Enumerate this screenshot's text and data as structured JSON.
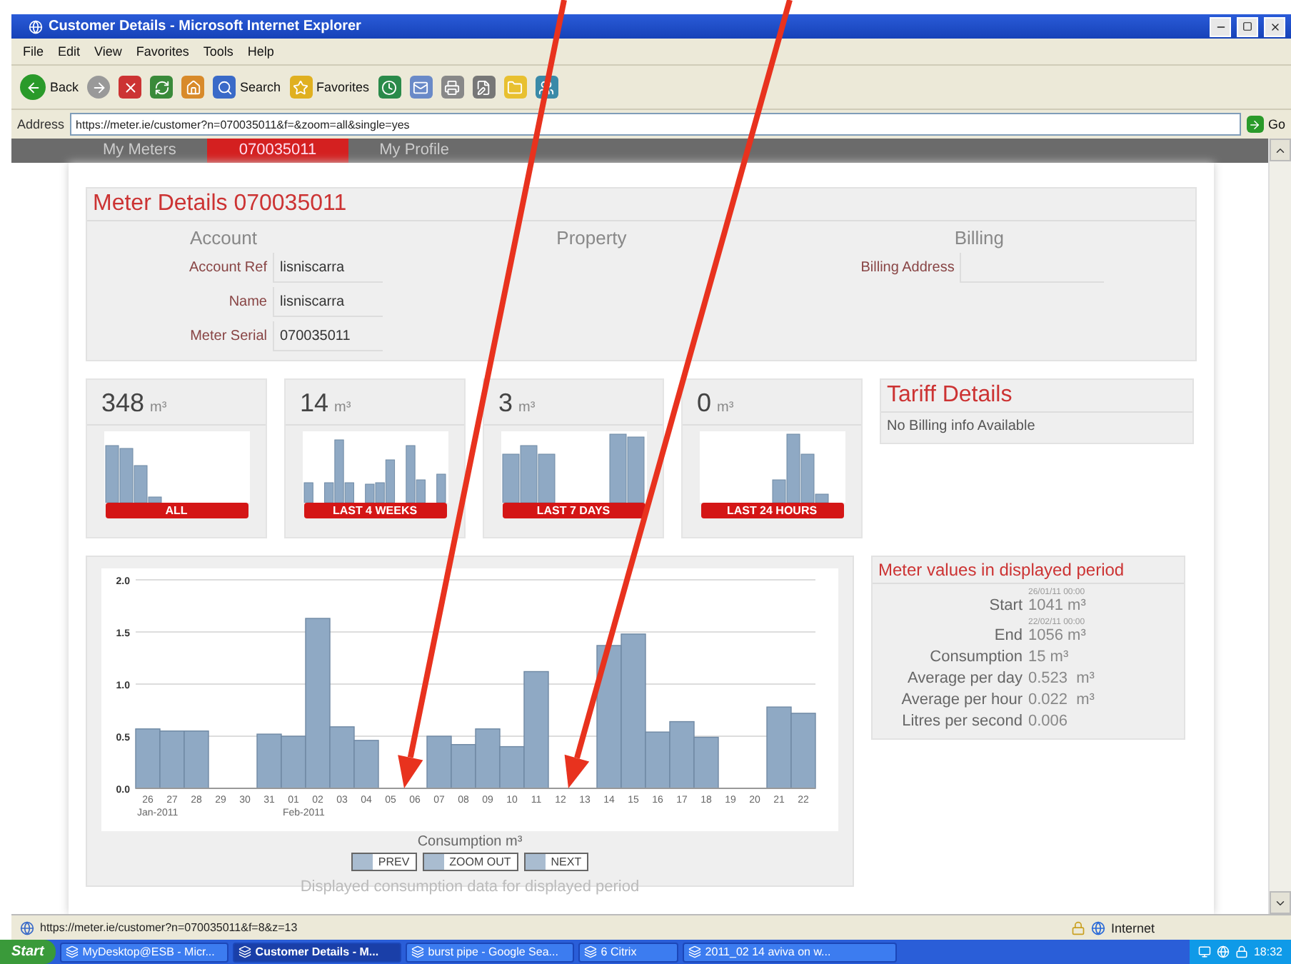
{
  "window": {
    "title": "Customer Details - Microsoft Internet Explorer"
  },
  "menu": [
    "File",
    "Edit",
    "View",
    "Favorites",
    "Tools",
    "Help"
  ],
  "toolbar": [
    {
      "kind": "back",
      "label": "Back"
    },
    {
      "kind": "forward"
    },
    {
      "kind": "stop"
    },
    {
      "kind": "refresh"
    },
    {
      "kind": "home"
    },
    {
      "kind": "search",
      "label": "Search"
    },
    {
      "kind": "favorites",
      "label": "Favorites"
    },
    {
      "kind": "history"
    },
    {
      "kind": "mail"
    },
    {
      "kind": "print"
    },
    {
      "kind": "edit"
    },
    {
      "kind": "folder"
    },
    {
      "kind": "messenger"
    }
  ],
  "address_bar": {
    "label": "Address",
    "value": "https://meter.ie/customer?n=070035011&f=&zoom=all&single=yes",
    "go": "Go"
  },
  "nav_tabs": [
    {
      "label": "My Meters",
      "selected": false
    },
    {
      "label": "070035011",
      "selected": true
    },
    {
      "label": "My Profile",
      "selected": false
    }
  ],
  "meter_details": {
    "title": "Meter Details 070035011",
    "sections": [
      "Account",
      "Property",
      "Billing"
    ],
    "account_fields": [
      {
        "label": "Account Ref",
        "value": "lisniscarra"
      },
      {
        "label": "Name",
        "value": "lisniscarra"
      },
      {
        "label": "Meter Serial",
        "value": "070035011"
      }
    ],
    "billing_fields": [
      {
        "label": "Billing Address"
      }
    ]
  },
  "usage_cards": [
    {
      "value": "348",
      "unit": "m³",
      "label": "ALL"
    },
    {
      "value": "14",
      "unit": "m³",
      "label": "LAST 4 WEEKS"
    },
    {
      "value": "3",
      "unit": "m³",
      "label": "LAST 7 DAYS"
    },
    {
      "value": "0",
      "unit": "m³",
      "label": "LAST 24 HOURS"
    }
  ],
  "tariff": {
    "title": "Tariff Details",
    "message": "No Billing info Available"
  },
  "consumption": {
    "chart_data": {
      "type": "bar",
      "xlabel": "Consumption m³",
      "categories": [
        "26",
        "27",
        "28",
        "29",
        "30",
        "31",
        "01",
        "02",
        "03",
        "04",
        "05",
        "06",
        "07",
        "08",
        "09",
        "10",
        "11",
        "12",
        "13",
        "14",
        "15",
        "16",
        "17",
        "18",
        "19",
        "20",
        "21",
        "22"
      ],
      "grid": true,
      "series": [
        {
          "color": "#8fa9c4",
          "values": [
            0.57,
            0.55,
            0.55,
            0,
            0,
            0.52,
            0.5,
            1.63,
            0.59,
            0.46,
            0,
            0,
            0.5,
            0.42,
            0.57,
            0.4,
            1.12,
            0,
            0,
            1.37,
            1.48,
            0.54,
            0.64,
            0.49,
            0,
            0,
            0.78,
            0.72
          ]
        }
      ],
      "ylim": [
        0,
        2
      ],
      "yticks": [
        {
          "value": 0,
          "label": "0.0"
        },
        {
          "value": 0.5,
          "label": "0.5"
        },
        {
          "value": 1,
          "label": "1.0"
        },
        {
          "value": 1.5,
          "label": "1.5"
        },
        {
          "value": 2,
          "label": "2.0"
        }
      ],
      "annotations": [
        "Jan-2011",
        "Feb-2011"
      ]
    },
    "buttons": [
      "PREV",
      "ZOOM OUT",
      "NEXT"
    ]
  },
  "meter_values": {
    "title": "Meter values in displayed period",
    "rows": [
      {
        "label": "Start",
        "date": "26/01/11 00:00",
        "value": "1041 m³"
      },
      {
        "label": "End",
        "date": "22/02/11 00:00",
        "value": "1056 m³"
      },
      {
        "label": "Consumption",
        "value": "15 m³"
      },
      {
        "label": "Average per day",
        "value": "0.523  m³"
      },
      {
        "label": "Average per hour",
        "value": "0.022  m³"
      },
      {
        "label": "Litres per second",
        "value": "0.006"
      }
    ]
  },
  "footer_note": "Displayed consumption data for displayed period",
  "status_bar": {
    "url": "https://meter.ie/customer?n=070035011&f=8&z=13",
    "zone": "Internet"
  },
  "taskbar": {
    "start": "Start",
    "items": [
      {
        "label": "MyDesktop@ESB - Micr...",
        "selected": false
      },
      {
        "label": "Customer Details - M...",
        "selected": true
      },
      {
        "label": "burst pipe - Google Sea...",
        "selected": false
      },
      {
        "label": "6 Citrix",
        "selected": false
      },
      {
        "label": "2011_02 14 aviva on w...",
        "selected": false
      }
    ],
    "clock": "18:32"
  }
}
